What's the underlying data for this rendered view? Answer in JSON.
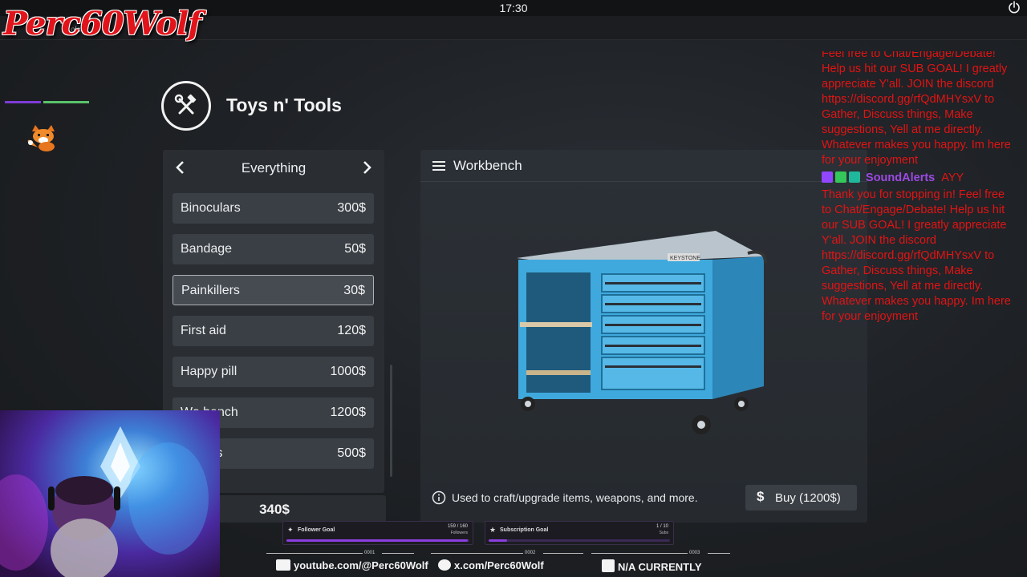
{
  "system": {
    "clock": "17:30"
  },
  "overlay": {
    "logo_text": "Perc60Wolf",
    "subbar_fragment": "ols"
  },
  "shop": {
    "title": "Toys n' Tools",
    "category": "Everything",
    "items": [
      {
        "name": "Binoculars",
        "price": "300$"
      },
      {
        "name": "Bandage",
        "price": "50$"
      },
      {
        "name": "Painkillers",
        "price": "30$"
      },
      {
        "name": "First aid",
        "price": "120$"
      },
      {
        "name": "Happy pill",
        "price": "1000$"
      },
      {
        "name": "Wo  bench",
        "price": "1200$"
      },
      {
        "name": "sia pills",
        "price": "500$"
      }
    ],
    "selected_index": 2,
    "money": "340$"
  },
  "detail": {
    "title": "Workbench",
    "description": "Used to craft/upgrade items, weapons, and more.",
    "buy_label": "Buy (1200$)",
    "currency_symbol": "$",
    "bench_plate": "KEYSTONE"
  },
  "chat": {
    "msg1": "Feel free to Chat/Engage/Debate! Help us hit our SUB GOAL! I greatly appreciate Y'all. JOIN the discord https://discord.gg/rfQdMHYsxV to Gather, Discuss things, Make suggestions, Yell at me directly. Whatever makes you happy. Im here for your enjoyment",
    "user": "SoundAlerts",
    "user_text": "AYY",
    "msg2": "Thank you for stopping in! Feel free to Chat/Engage/Debate! Help us hit our SUB GOAL! I greatly appreciate Y'all. JOIN the discord https://discord.gg/rfQdMHYsxV to Gather, Discuss things, Make suggestions, Yell at me directly. Whatever makes you happy. Im here for your enjoyment"
  },
  "goals": {
    "follower": {
      "label": "Follower Goal",
      "count": "159 / 160",
      "unit": "Followers",
      "progress": 0.99
    },
    "subscription": {
      "label": "Subscription Goal",
      "count": "1 / 10",
      "unit": "Subs",
      "progress": 0.1
    }
  },
  "social": {
    "youtube": "youtube.com/@Perc60Wolf",
    "x": "x.com/Perc60Wolf",
    "facebook": "N/A CURRENTLY",
    "seg1": "0001",
    "seg2": "0002",
    "seg3": "0003"
  },
  "colors": {
    "accent_purple": "#8a3fe0",
    "chat_red": "#e11414",
    "bench_blue": "#3fa9dd"
  }
}
